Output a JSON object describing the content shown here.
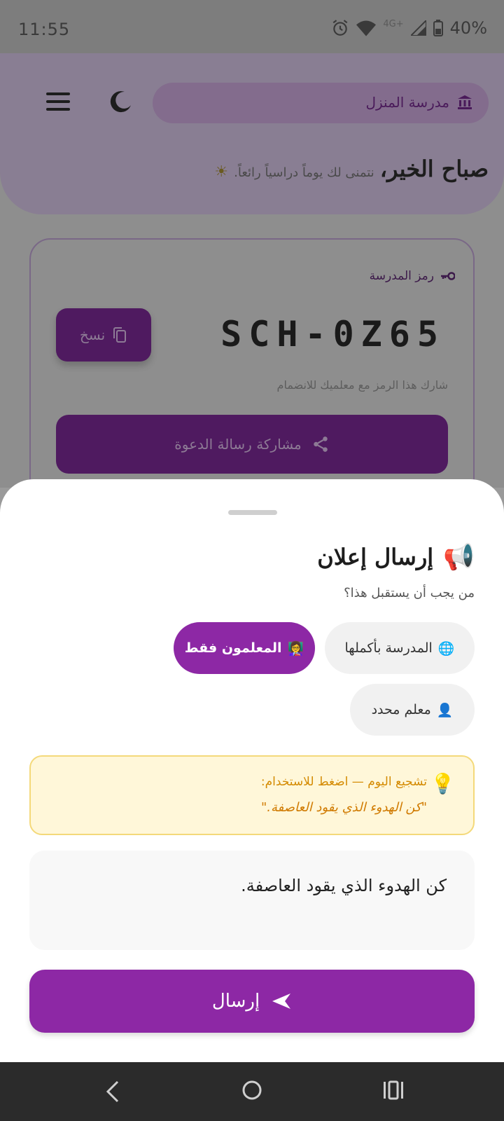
{
  "status_bar": {
    "time": "11:55",
    "network": "4G+",
    "battery": "40%"
  },
  "header": {
    "school_name": "مدرسة المنزل",
    "greeting_title": "صباح الخير،",
    "greeting_sub": "نتمنى لك يوماً دراسياً رائعاً.",
    "greeting_emoji": "☀"
  },
  "code_card": {
    "label": "رمز المدرسة",
    "code": "SCH-0Z65",
    "copy_label": "نسخ",
    "hint": "شارك هذا الرمز مع معلميك للانضمام",
    "share_label": "مشاركة رسالة الدعوة"
  },
  "sheet": {
    "title": "إرسال إعلان",
    "title_emoji": "📢",
    "question": "من يجب أن يستقبل هذا؟",
    "audience_options": [
      {
        "label": "المدرسة بأكملها",
        "emoji": "🌐",
        "selected": false
      },
      {
        "label": "المعلمون فقط",
        "emoji": "👩‍🏫",
        "selected": true
      },
      {
        "label": "معلم محدد",
        "emoji": "👤",
        "selected": false
      }
    ],
    "tip_title": "تشجيع اليوم — اضغط للاستخدام:",
    "tip_quote": "\"كن الهدوء الذي يقود العاصفة.\"",
    "tip_emoji": "💡",
    "message_text": "كن الهدوء الذي يقود العاصفة.",
    "send_label": "إرسال"
  },
  "colors": {
    "accent": "#8d28a5",
    "tip_bg": "#fff7d9",
    "tip_text": "#d48a00"
  }
}
